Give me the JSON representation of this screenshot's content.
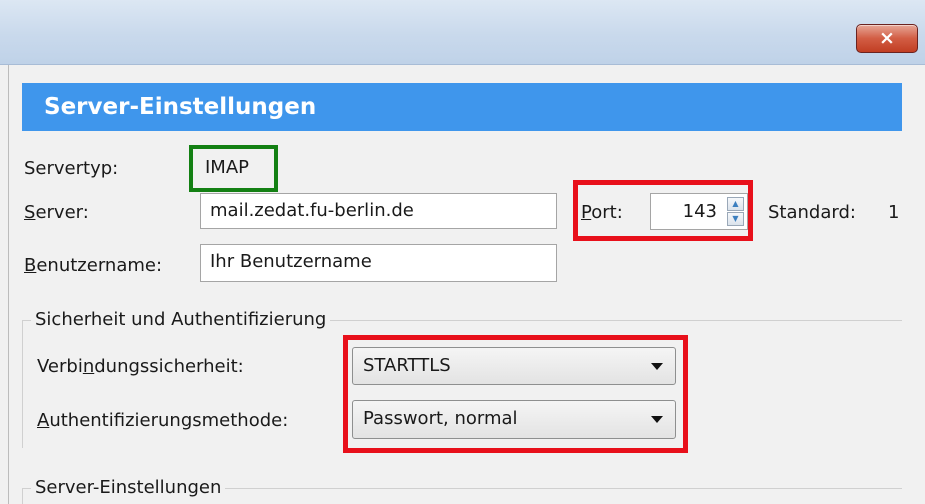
{
  "window": {
    "close_glyph": "×"
  },
  "header": {
    "title": "Server-Einstellungen"
  },
  "server": {
    "type_label": "Servertyp:",
    "type_value": "IMAP",
    "server_label_first": "S",
    "server_label_rest": "erver:",
    "server_value": "mail.zedat.fu-berlin.de",
    "port_label_first": "P",
    "port_label_rest": "ort:",
    "port_value": "143",
    "standard_label": "Standard:",
    "standard_value": "1",
    "username_label_first": "B",
    "username_label_rest": "enutzername:",
    "username_value": "Ihr Benutzername"
  },
  "security": {
    "group_title": "Sicherheit und Authentifizierung",
    "conn_label_a": "Verbi",
    "conn_label_u": "n",
    "conn_label_b": "dungssicherheit:",
    "conn_value": "STARTTLS",
    "auth_label_a": "A",
    "auth_label_b": "uthentifizierungsmethode:",
    "auth_value": "Passwort, normal"
  },
  "server_settings_group": {
    "title": "Server-Einstellungen"
  },
  "colors": {
    "header_bg": "#3f96ec",
    "highlight_red": "#e8101b",
    "highlight_green": "#138013"
  }
}
